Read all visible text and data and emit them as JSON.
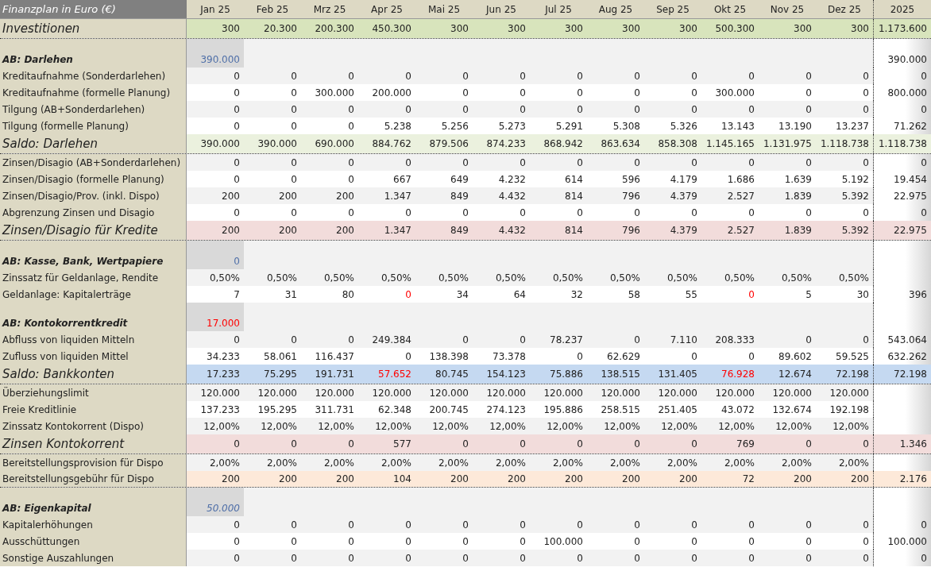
{
  "sheet": {
    "title": "Finanzplan in Euro (€)",
    "columns": [
      "Jan 25",
      "Feb 25",
      "Mrz 25",
      "Apr 25",
      "Mai 25",
      "Jun 25",
      "Jul 25",
      "Aug 25",
      "Sep 25",
      "Okt 25",
      "Nov 25",
      "Dez 25"
    ],
    "total_column": "2025",
    "rows": [
      {
        "kind": "summary",
        "label": "Investitionen",
        "color": "#d8e4bc",
        "values": [
          "300",
          "20.300",
          "200.300",
          "450.300",
          "300",
          "300",
          "300",
          "300",
          "300",
          "500.300",
          "300",
          "300"
        ],
        "total": "1.173.600"
      },
      {
        "kind": "opening",
        "label": "AB: Darlehen",
        "opening": {
          "text": "390.000",
          "color": "#4f6fa8",
          "italic": false
        },
        "total": "390.000"
      },
      {
        "kind": "line",
        "label": "Kreditaufnahme (Sonderdarlehen)",
        "values": [
          "0",
          "0",
          "0",
          "0",
          "0",
          "0",
          "0",
          "0",
          "0",
          "0",
          "0",
          "0"
        ],
        "total": "0"
      },
      {
        "kind": "line",
        "label": "Kreditaufnahme (formelle Planung)",
        "values": [
          "0",
          "0",
          "300.000",
          "200.000",
          "0",
          "0",
          "0",
          "0",
          "0",
          "300.000",
          "0",
          "0"
        ],
        "total": "800.000"
      },
      {
        "kind": "line",
        "label": "Tilgung (AB+Sonderdarlehen)",
        "values": [
          "0",
          "0",
          "0",
          "0",
          "0",
          "0",
          "0",
          "0",
          "0",
          "0",
          "0",
          "0"
        ],
        "total": "0"
      },
      {
        "kind": "line",
        "label": "Tilgung (formelle Planung)",
        "values": [
          "0",
          "0",
          "0",
          "5.238",
          "5.256",
          "5.273",
          "5.291",
          "5.308",
          "5.326",
          "13.143",
          "13.190",
          "13.237"
        ],
        "total": "71.262"
      },
      {
        "kind": "summary",
        "label": "Saldo: Darlehen",
        "color": "#ebf1de",
        "values": [
          "390.000",
          "390.000",
          "690.000",
          "884.762",
          "879.506",
          "874.233",
          "868.942",
          "863.634",
          "858.308",
          "1.145.165",
          "1.131.975",
          "1.118.738"
        ],
        "total": "1.118.738"
      },
      {
        "kind": "line",
        "label": "Zinsen/Disagio (AB+Sonderdarlehen)",
        "values": [
          "0",
          "0",
          "0",
          "0",
          "0",
          "0",
          "0",
          "0",
          "0",
          "0",
          "0",
          "0"
        ],
        "total": "0"
      },
      {
        "kind": "line",
        "label": "Zinsen/Disagio (formelle Planung)",
        "values": [
          "0",
          "0",
          "0",
          "667",
          "649",
          "4.232",
          "614",
          "596",
          "4.179",
          "1.686",
          "1.639",
          "5.192"
        ],
        "total": "19.454"
      },
      {
        "kind": "line",
        "label": "Zinsen/Disagio/Prov. (inkl. Dispo)",
        "values": [
          "200",
          "200",
          "200",
          "1.347",
          "849",
          "4.432",
          "814",
          "796",
          "4.379",
          "2.527",
          "1.839",
          "5.392"
        ],
        "total": "22.975"
      },
      {
        "kind": "line",
        "label": "Abgrenzung Zinsen und Disagio",
        "values": [
          "0",
          "0",
          "0",
          "0",
          "0",
          "0",
          "0",
          "0",
          "0",
          "0",
          "0",
          "0"
        ],
        "total": "0"
      },
      {
        "kind": "summary",
        "label": "Zinsen/Disagio für Kredite",
        "color": "#f2dcdb",
        "values": [
          "200",
          "200",
          "200",
          "1.347",
          "849",
          "4.432",
          "814",
          "796",
          "4.379",
          "2.527",
          "1.839",
          "5.392"
        ],
        "total": "22.975"
      },
      {
        "kind": "opening",
        "label": "AB: Kasse, Bank, Wertpapiere",
        "opening": {
          "text": "0",
          "color": "#4f6fa8",
          "italic": false
        }
      },
      {
        "kind": "line",
        "label": "Zinssatz für Geldanlage, Rendite",
        "values": [
          "0,50%",
          "0,50%",
          "0,50%",
          "0,50%",
          "0,50%",
          "0,50%",
          "0,50%",
          "0,50%",
          "0,50%",
          "0,50%",
          "0,50%",
          "0,50%"
        ]
      },
      {
        "kind": "line",
        "label": "Geldanlage: Kapitalerträge",
        "values": [
          "7",
          "31",
          "80",
          {
            "text": "0",
            "red": true
          },
          "34",
          "64",
          "32",
          "58",
          "55",
          {
            "text": "0",
            "red": true
          },
          "5",
          "30"
        ],
        "total": "396"
      },
      {
        "kind": "opening",
        "label": "AB: Kontokorrentkredit",
        "opening": {
          "text": "17.000",
          "color": "#ff0000",
          "italic": false
        }
      },
      {
        "kind": "line",
        "label": "Abfluss von liquiden Mitteln",
        "values": [
          "0",
          "0",
          "0",
          "249.384",
          "0",
          "0",
          "78.237",
          "0",
          "7.110",
          "208.333",
          "0",
          "0"
        ],
        "total": "543.064"
      },
      {
        "kind": "line",
        "label": "Zufluss von liquiden Mittel",
        "values": [
          "34.233",
          "58.061",
          "116.437",
          "0",
          "138.398",
          "73.378",
          "0",
          "62.629",
          "0",
          "0",
          "89.602",
          "59.525"
        ],
        "total": "632.262"
      },
      {
        "kind": "summary",
        "label": "Saldo: Bankkonten",
        "color": "#c5d9f1",
        "values": [
          "17.233",
          "75.295",
          "191.731",
          {
            "text": "57.652",
            "red": true
          },
          "80.745",
          "154.123",
          "75.886",
          "138.515",
          "131.405",
          {
            "text": "76.928",
            "red": true
          },
          "12.674",
          "72.198"
        ],
        "total": "72.198"
      },
      {
        "kind": "line",
        "label": "Überziehungslimit",
        "values": [
          "120.000",
          "120.000",
          "120.000",
          "120.000",
          "120.000",
          "120.000",
          "120.000",
          "120.000",
          "120.000",
          "120.000",
          "120.000",
          "120.000"
        ]
      },
      {
        "kind": "line",
        "label": "Freie Kreditlinie",
        "values": [
          "137.233",
          "195.295",
          "311.731",
          "62.348",
          "200.745",
          "274.123",
          "195.886",
          "258.515",
          "251.405",
          "43.072",
          "132.674",
          "192.198"
        ]
      },
      {
        "kind": "line",
        "label": "Zinssatz Kontokorrent (Dispo)",
        "values": [
          "12,00%",
          "12,00%",
          "12,00%",
          "12,00%",
          "12,00%",
          "12,00%",
          "12,00%",
          "12,00%",
          "12,00%",
          "12,00%",
          "12,00%",
          "12,00%"
        ]
      },
      {
        "kind": "summary",
        "label": "Zinsen Kontokorrent",
        "color": "#f2dcdb",
        "values": [
          "0",
          "0",
          "0",
          "577",
          "0",
          "0",
          "0",
          "0",
          "0",
          "769",
          "0",
          "0"
        ],
        "total": "1.346"
      },
      {
        "kind": "line",
        "label": "Bereitstellungsprovision für Dispo",
        "values": [
          "2,00%",
          "2,00%",
          "2,00%",
          "2,00%",
          "2,00%",
          "2,00%",
          "2,00%",
          "2,00%",
          "2,00%",
          "2,00%",
          "2,00%",
          "2,00%"
        ]
      },
      {
        "kind": "line",
        "label": "Bereitstellungsgebühr für Dispo",
        "color": "#fde9d9",
        "values": [
          "200",
          "200",
          "200",
          "104",
          "200",
          "200",
          "200",
          "200",
          "200",
          "72",
          "200",
          "200"
        ],
        "total": "2.176"
      },
      {
        "kind": "opening",
        "label": "AB: Eigenkapital",
        "opening": {
          "text": "50.000",
          "color": "#4f6fa8",
          "italic": true
        }
      },
      {
        "kind": "line",
        "label": "Kapitalerhöhungen",
        "values": [
          "0",
          "0",
          "0",
          "0",
          "0",
          "0",
          "0",
          "0",
          "0",
          "0",
          "0",
          "0"
        ],
        "total": "0"
      },
      {
        "kind": "line",
        "label": "Ausschüttungen",
        "values": [
          "0",
          "0",
          "0",
          "0",
          "0",
          "0",
          "100.000",
          "0",
          "0",
          "0",
          "0",
          "0"
        ],
        "total": "100.000"
      },
      {
        "kind": "line",
        "label": "Sonstige Auszahlungen",
        "values": [
          "0",
          "0",
          "0",
          "0",
          "0",
          "0",
          "0",
          "0",
          "0",
          "0",
          "0",
          "0"
        ],
        "total": "0"
      }
    ]
  }
}
